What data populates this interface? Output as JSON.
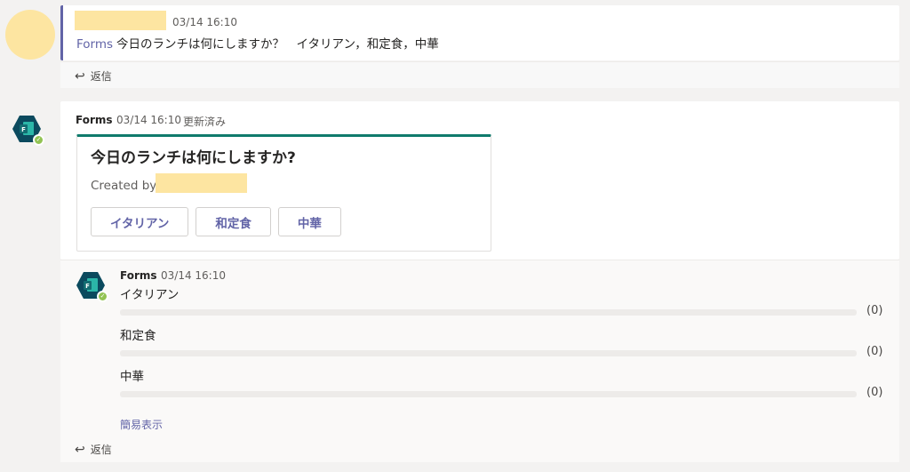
{
  "message1": {
    "timestamp": "03/14 16:10",
    "app_link": "Forms",
    "text": "今日のランチは何にしますか？　イタリアン，和定食，中華",
    "reply_label": "返信"
  },
  "message2": {
    "sender": "Forms",
    "timestamp": "03/14 16:10",
    "edited": "更新済み",
    "card": {
      "question": "今日のランチは何にしますか?",
      "created_by_label": "Created by",
      "options": [
        "イタリアン",
        "和定食",
        "中華"
      ]
    }
  },
  "thread": {
    "sender": "Forms",
    "timestamp": "03/14 16:10",
    "results": [
      {
        "label": "イタリアン",
        "count": "(0)",
        "fraction": 0
      },
      {
        "label": "和定食",
        "count": "(0)",
        "fraction": 0
      },
      {
        "label": "中華",
        "count": "(0)",
        "fraction": 0
      }
    ],
    "simple_view_label": "簡易表示",
    "reply_label": "返信"
  },
  "colors": {
    "accent": "#6264a7",
    "card_border": "#0f7b6c",
    "redaction": "#fde5a1",
    "status_online": "#92c353"
  },
  "icons": {
    "reply": "reply-arrow-icon",
    "forms_app": "microsoft-forms-icon",
    "status": "check-status-icon"
  }
}
